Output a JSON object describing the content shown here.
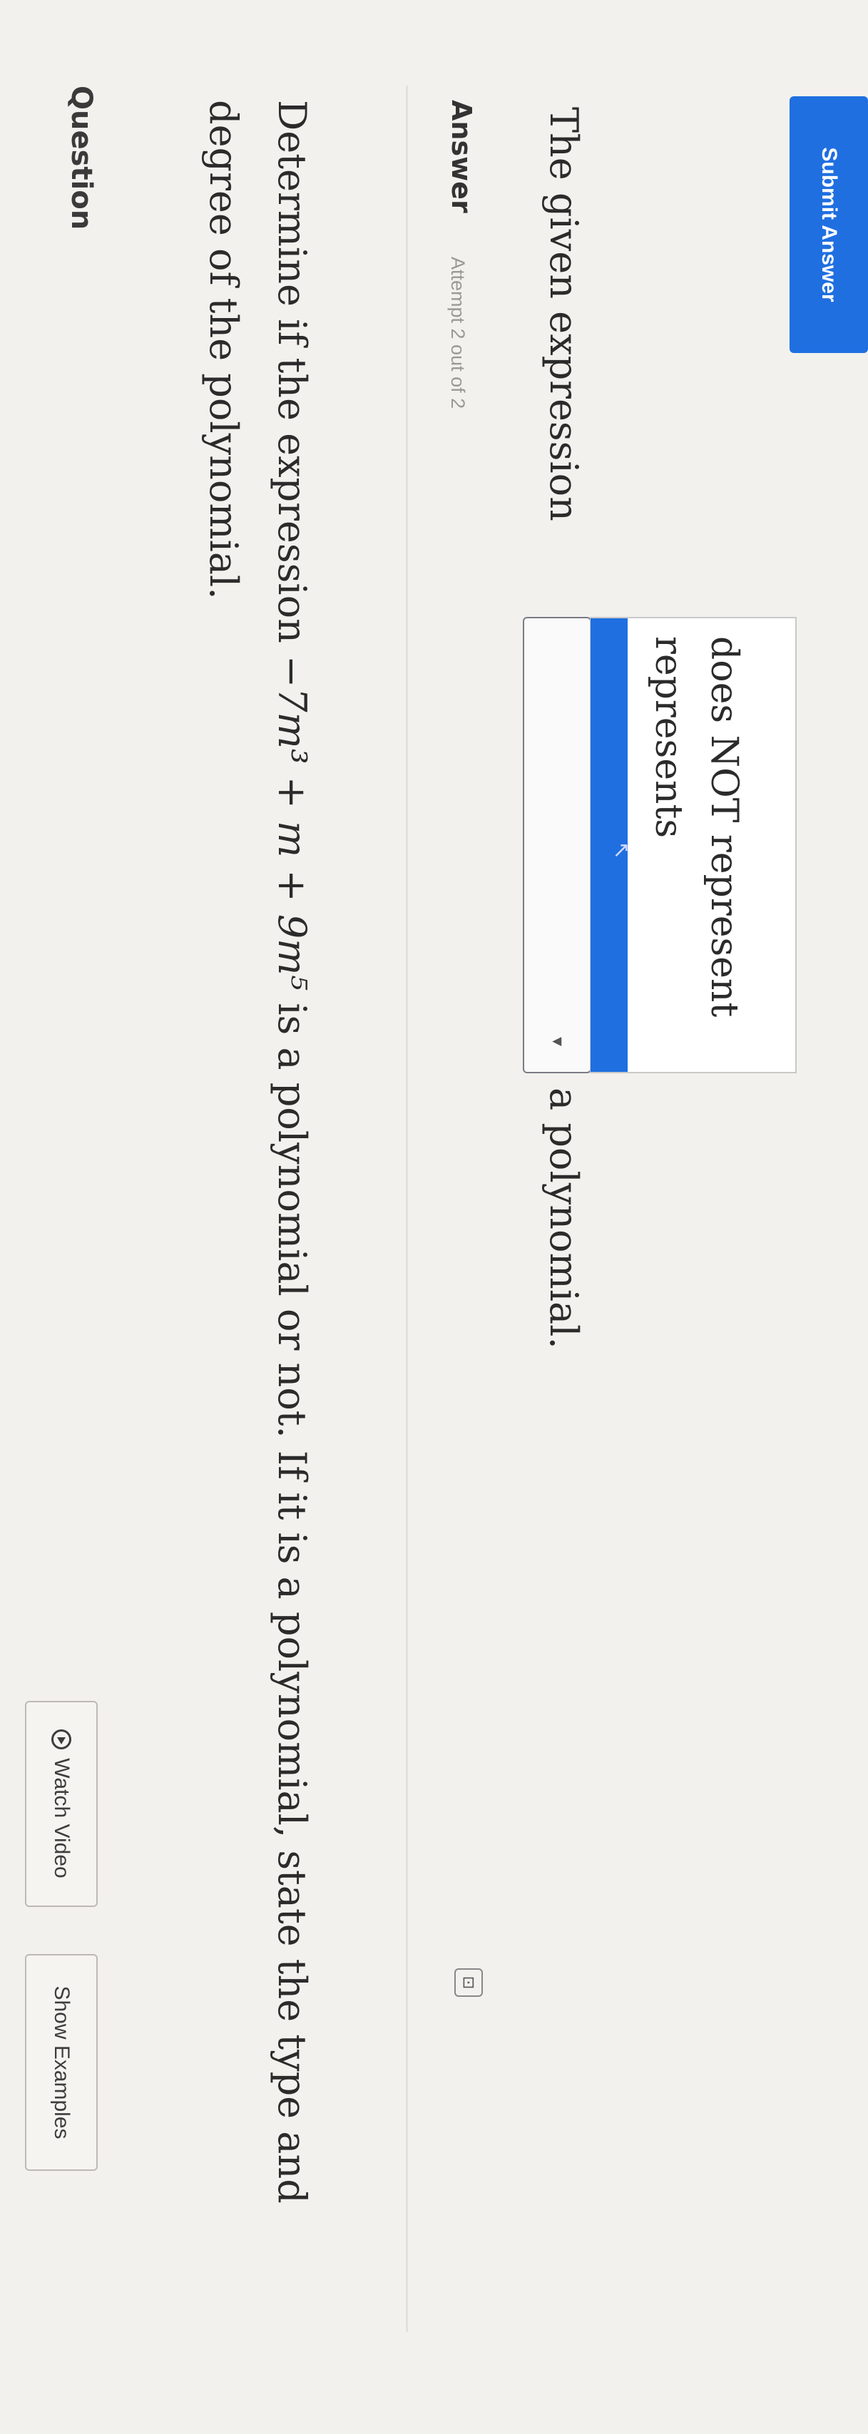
{
  "header": {
    "question_label": "Question",
    "watch_video_label": "Watch Video",
    "show_examples_label": "Show Examples"
  },
  "question": {
    "prefix": "Determine if the expression ",
    "expression": "−7m³ + m + 9m⁵",
    "suffix": " is a polynomial or not. If it is a polynomial, state the type and degree of the polynomial."
  },
  "answer": {
    "label": "Answer",
    "attempt_text": "Attempt 2 out of 2",
    "sentence_start": "The given expression",
    "sentence_end": "a polynomial.",
    "dropdown_value": "",
    "dropdown_options": [
      "represents",
      "does NOT represent"
    ],
    "submit_label": "Submit Answer"
  },
  "icons": {
    "video": "play-circle-icon",
    "dropdown": "chevron-down-icon",
    "cursor": "pointer-cursor-icon",
    "expand": "expand-icon"
  },
  "colors": {
    "accent": "#1f6fe0",
    "background": "#f3f1ed",
    "text": "#2b2b2b"
  }
}
